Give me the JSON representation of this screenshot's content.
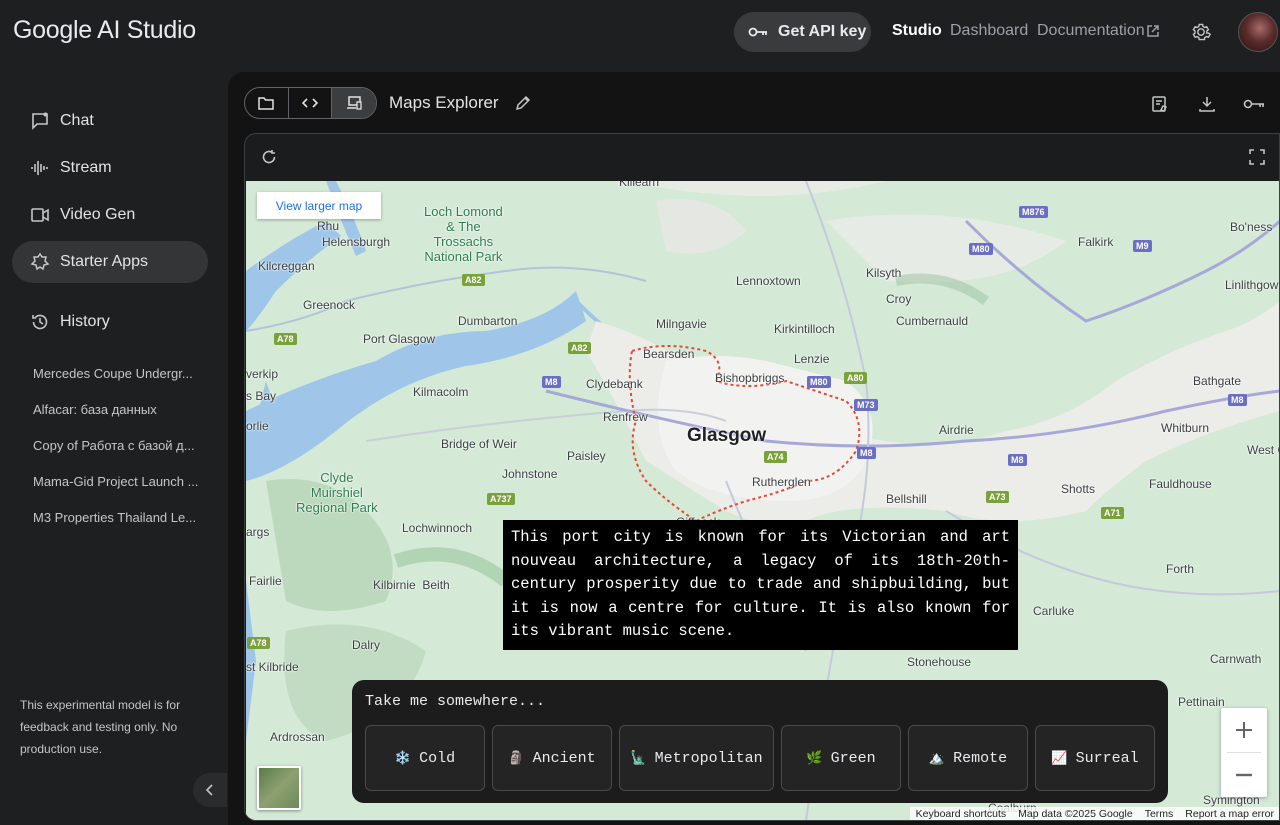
{
  "header": {
    "logo": "Google AI Studio",
    "api_key_label": "Get API key",
    "nav": [
      "Studio",
      "Dashboard",
      "Documentation"
    ]
  },
  "sidebar": {
    "items": [
      {
        "label": "Chat",
        "icon": "chat-icon"
      },
      {
        "label": "Stream",
        "icon": "waveform-icon"
      },
      {
        "label": "Video Gen",
        "icon": "video-icon"
      },
      {
        "label": "Starter Apps",
        "icon": "apps-icon",
        "active": true
      },
      {
        "label": "History",
        "icon": "history-icon"
      }
    ],
    "history": [
      "Mercedes Coupe Undergr...",
      "Alfacar: база данных",
      "Copy of Работа с базой д...",
      "Mama-Gid Project Launch ...",
      "M3 Properties Thailand Le..."
    ],
    "disclaimer": "This experimental model is for feedback and testing only. No production use."
  },
  "app": {
    "title": "Maps Explorer"
  },
  "map": {
    "view_larger": "View larger map",
    "places": {
      "killearn": "Killearn",
      "loch_lomond": "Loch Lomond\n& The\nTrossachs\nNational Park",
      "rhu": "Rhu",
      "helensburgh": "Helensburgh",
      "kilcreggan": "Kilcreggan",
      "greenock": "Greenock",
      "dumbarton": "Dumbarton",
      "port_glasgow": "Port Glasgow",
      "lennoxtown": "Lennoxtown",
      "kilsyth": "Kilsyth",
      "croy": "Croy",
      "cumbernauld": "Cumbernauld",
      "falkirk": "Falkirk",
      "boness": "Bo'ness",
      "linlithgow": "Linlithgow",
      "milngavie": "Milngavie",
      "kirkintilloch": "Kirkintilloch",
      "bearsden": "Bearsden",
      "lenzie": "Lenzie",
      "bishopbriggs": "Bishopbriggs",
      "clydebank": "Clydebank",
      "renfrew": "Renfrew",
      "glasgow": "Glasgow",
      "kilmacolm": "Kilmacolm",
      "bridge_of_weir": "Bridge of Weir",
      "paisley": "Paisley",
      "johnstone": "Johnstone",
      "rutherglen": "Rutherglen",
      "airdrie": "Airdrie",
      "bathgate": "Bathgate",
      "whitburn": "Whitburn",
      "west_calder": "West Ca",
      "shotts": "Shotts",
      "fauldhouse": "Fauldhouse",
      "bellshill": "Bellshill",
      "clyde_muirshiel": "Clyde\nMuirshiel\nRegional Park",
      "lochwinnoch": "Lochwinnoch",
      "kilbirnie_beith": "Kilbirnie  Beith",
      "fairlie": "Fairlie",
      "dalry": "Dalry",
      "west_kilbride": "st Kilbride",
      "ardrossan": "Ardrossan",
      "forth": "Forth",
      "carluke": "Carluke",
      "stonehouse": "Stonehouse",
      "carnwath": "Carnwath",
      "pettinain": "Pettinain",
      "symington": "Symington",
      "wemyss_bay": "s Bay",
      "inverkip": "verkip",
      "largs": "args",
      "skelmorlie": "orlie",
      "giffnock": "Giffnock",
      "coalburn": "Coalburn"
    },
    "roads": [
      "M876",
      "M80",
      "M9",
      "A82",
      "A78",
      "M8",
      "A80",
      "M73",
      "A74",
      "A737",
      "A73",
      "A71"
    ],
    "info_text": "This port city is known for its Victorian and art nouveau architecture, a legacy of its 18th-20th-century prosperity due to trade and shipbuilding, but it is now a centre for culture. It is also known for its vibrant music scene.",
    "prompt_label": "Take me somewhere...",
    "chips": [
      {
        "icon": "❄️",
        "label": "Cold"
      },
      {
        "icon": "🗿",
        "label": "Ancient"
      },
      {
        "icon": "🗽",
        "label": "Metropolitan"
      },
      {
        "icon": "🌿",
        "label": "Green"
      },
      {
        "icon": "🏔️",
        "label": "Remote"
      },
      {
        "icon": "📈",
        "label": "Surreal"
      }
    ],
    "attribution": [
      "Keyboard shortcuts",
      "Map data ©2025 Google",
      "Terms",
      "Report a map error"
    ]
  }
}
